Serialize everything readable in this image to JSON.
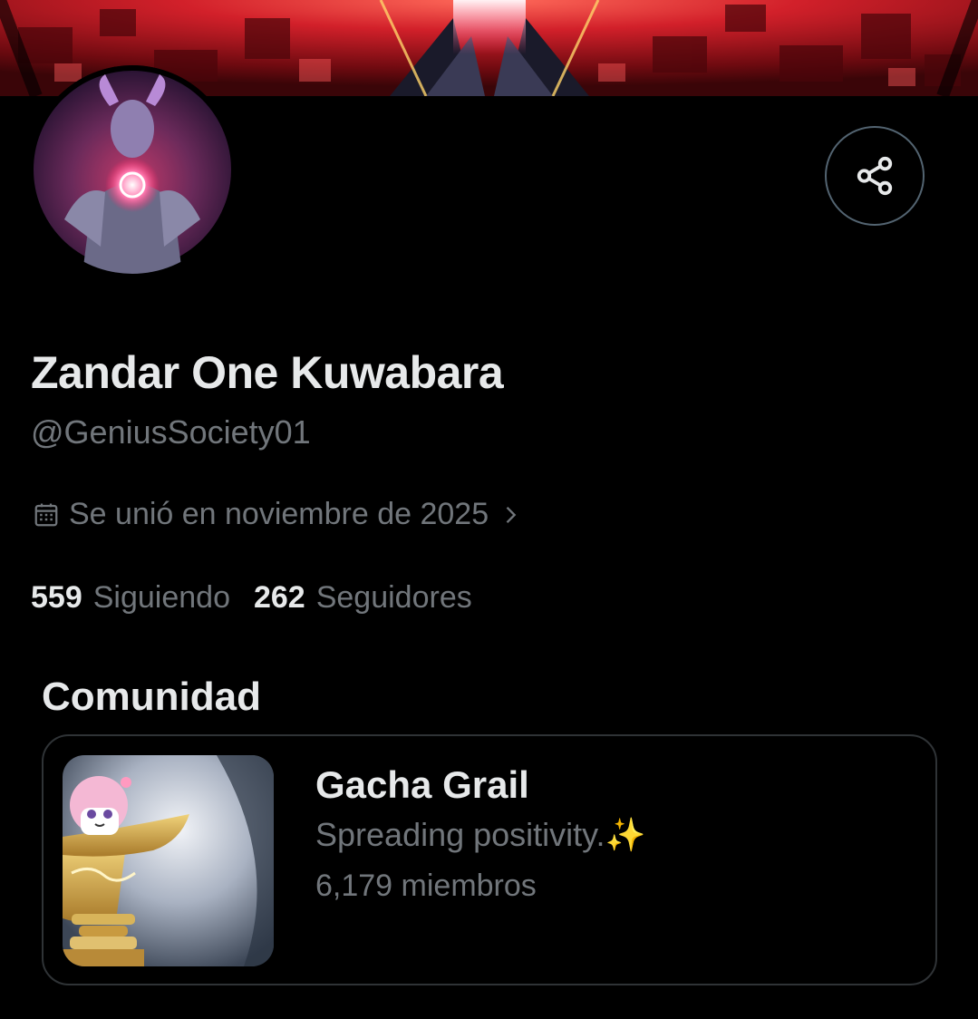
{
  "profile": {
    "display_name": "Zandar One Kuwabara",
    "handle": "@GeniusSociety01",
    "joined": "Se unió en noviembre de 2025",
    "following_count": "559",
    "following_label": "Siguiendo",
    "followers_count": "262",
    "followers_label": "Seguidores"
  },
  "community_section": {
    "title": "Comunidad",
    "card": {
      "name": "Gacha Grail",
      "description": "Spreading positivity.✨",
      "members": "6,179 miembros"
    }
  },
  "icons": {
    "share": "share-icon",
    "calendar": "calendar-icon",
    "chevron": "chevron-right-icon"
  },
  "colors": {
    "background": "#000000",
    "text_primary": "#e7e9ea",
    "text_secondary": "#71767b",
    "border": "#2f3336",
    "banner_red": "#c81a22"
  }
}
